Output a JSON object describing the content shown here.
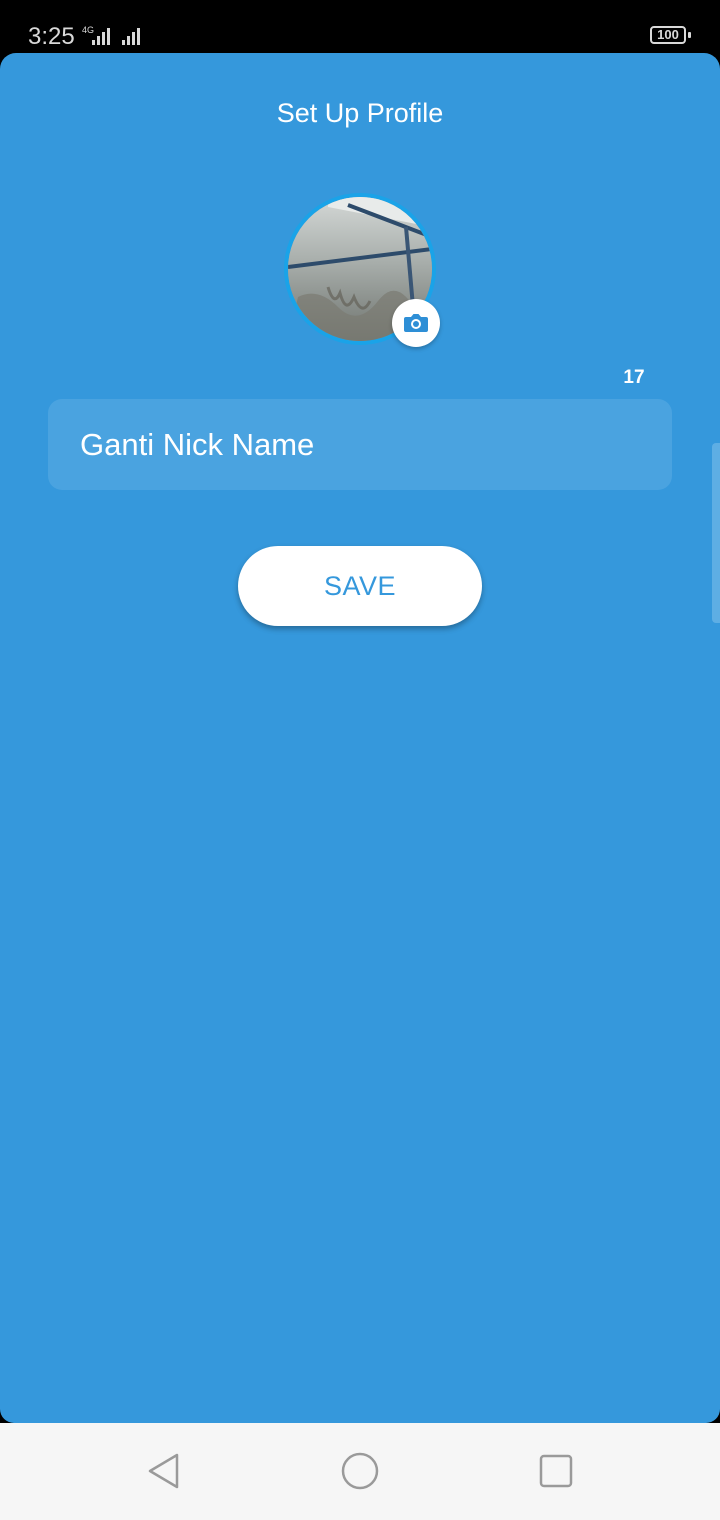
{
  "status_bar": {
    "time": "3:25",
    "network_label": "4G",
    "battery": "100"
  },
  "header": {
    "title": "Set Up Profile"
  },
  "profile": {
    "avatar_alt": "profile photo",
    "camera_icon": "camera-icon"
  },
  "nickname": {
    "char_counter": "17",
    "value": "Ganti Nick Name",
    "placeholder": ""
  },
  "actions": {
    "save_label": "SAVE"
  },
  "navigation": {
    "back_icon": "back-triangle-icon",
    "home_icon": "home-circle-icon",
    "recents_icon": "recents-square-icon"
  },
  "colors": {
    "background": "#3598dc",
    "field": "#4aa3e0",
    "avatar_ring": "#1aa3e8",
    "button_bg": "#ffffff",
    "button_text": "#3598dc"
  }
}
